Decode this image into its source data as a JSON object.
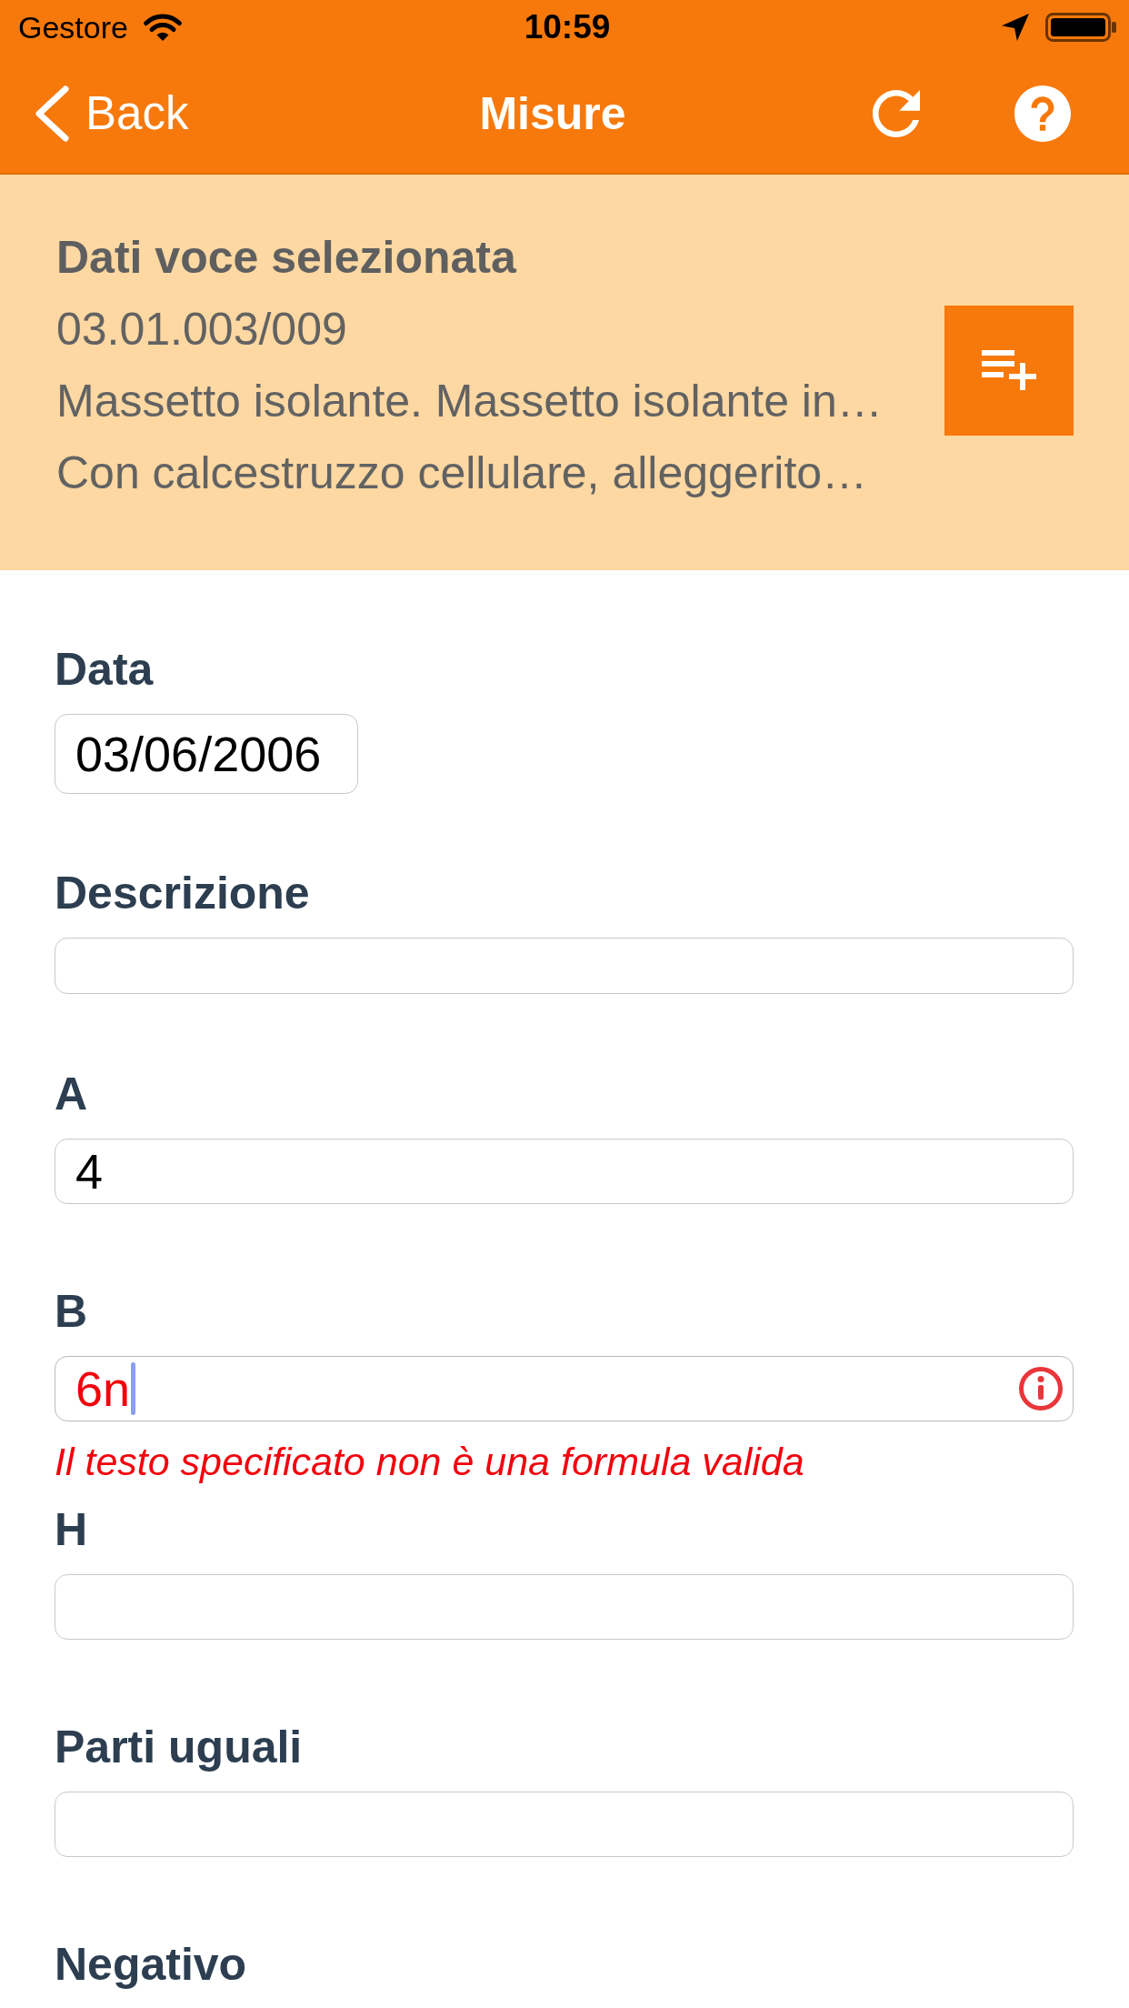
{
  "status_bar": {
    "carrier": "Gestore",
    "time": "10:59"
  },
  "nav_bar": {
    "back_label": "Back",
    "title": "Misure"
  },
  "selected_item": {
    "heading": "Dati voce selezionata",
    "code": "03.01.003/009",
    "description_lines": [
      "Massetto isolante. Massetto isolante in…",
      "Con calcestruzzo cellulare, alleggerito…"
    ]
  },
  "form": {
    "fields": [
      {
        "label": "Data",
        "kind": "date",
        "value": "03/06/2006",
        "focused": false
      },
      {
        "label": "Descrizione",
        "kind": "text",
        "focused": false
      },
      {
        "label": "A",
        "kind": "formula",
        "value": "4",
        "focused": false
      },
      {
        "label": "B",
        "kind": "formula",
        "value": "6n",
        "focused": true,
        "error": "Il testo specificato non è una formula valida"
      },
      {
        "label": "H",
        "kind": "formula",
        "focused": false
      },
      {
        "label": "Parti uguali",
        "kind": "formula",
        "focused": false
      },
      {
        "label": "Negativo",
        "kind": "label_only"
      }
    ]
  }
}
